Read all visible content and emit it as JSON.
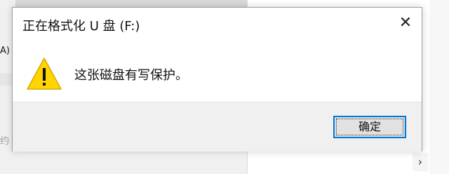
{
  "background": {
    "left_rows": [
      {
        "text": ""
      },
      {
        "text": ""
      },
      {
        "text": "A)"
      },
      {
        "text": ""
      }
    ],
    "bottom_left_text": "约",
    "scroll_arrow": "›"
  },
  "dialog": {
    "title": "正在格式化 U 盘 (F:)",
    "close_glyph": "✕",
    "icon": "warning-icon",
    "message": "这张磁盘有写保护。",
    "ok_label": "确定",
    "colors": {
      "warning_fill": "#ffd400",
      "focus_border": "#0078d7",
      "footer_bg": "#f0f0f0"
    }
  }
}
